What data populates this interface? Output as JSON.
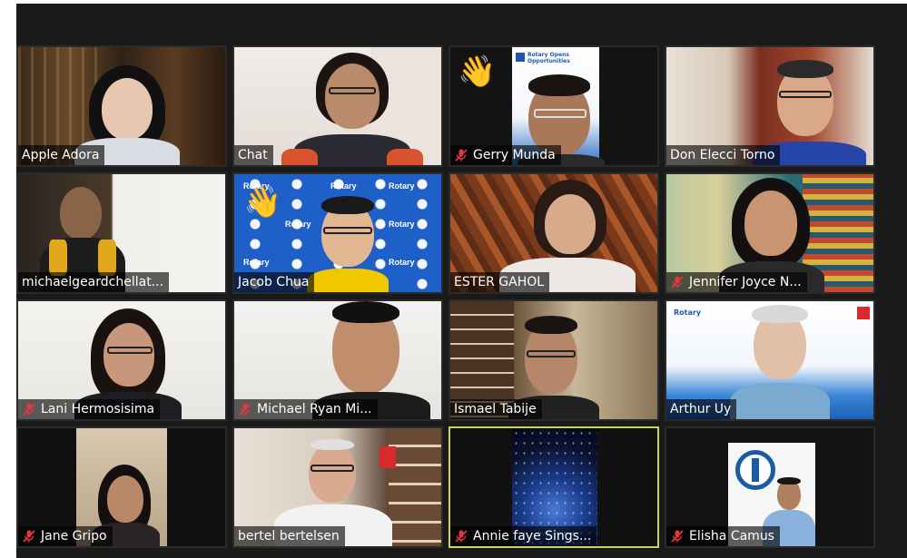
{
  "app": {
    "name": "Zoom gallery view"
  },
  "participants": [
    {
      "name": "Apple Adora",
      "muted": false
    },
    {
      "name": "Chat",
      "muted": false
    },
    {
      "name": "Gerry Munda",
      "muted": true,
      "hand_raised": true
    },
    {
      "name": "Don Elecci Torno",
      "muted": false
    },
    {
      "name": "michaelgeardchellat...",
      "muted": false
    },
    {
      "name": "Jacob Chua",
      "muted": false,
      "hand_raised": true
    },
    {
      "name": "ESTER GAHOL",
      "muted": false
    },
    {
      "name": "Jennifer Joyce N...",
      "muted": true
    },
    {
      "name": "Lani Hermosisima",
      "muted": true
    },
    {
      "name": "Michael Ryan Mi...",
      "muted": true
    },
    {
      "name": "Ismael Tabije",
      "muted": false
    },
    {
      "name": "Arthur Uy",
      "muted": false
    },
    {
      "name": "Jane Gripo",
      "muted": true
    },
    {
      "name": "bertel bertelsen",
      "muted": false
    },
    {
      "name": "Annie faye Sings...",
      "muted": true,
      "speaking": true
    },
    {
      "name": "Elisha Camus",
      "muted": true
    }
  ],
  "backgrounds": {
    "rotary_word": "Rotary",
    "rotary_slide_line1": "Rotary Opens",
    "rotary_slide_line2": "Opportunities"
  },
  "colors": {
    "speaking_border": "#c8d65a",
    "muted_mic": "#e0383e",
    "window_bg": "#1a1a1a"
  },
  "icons": {
    "muted": "muted-microphone-icon",
    "raise_hand": "raised-hand-icon"
  }
}
